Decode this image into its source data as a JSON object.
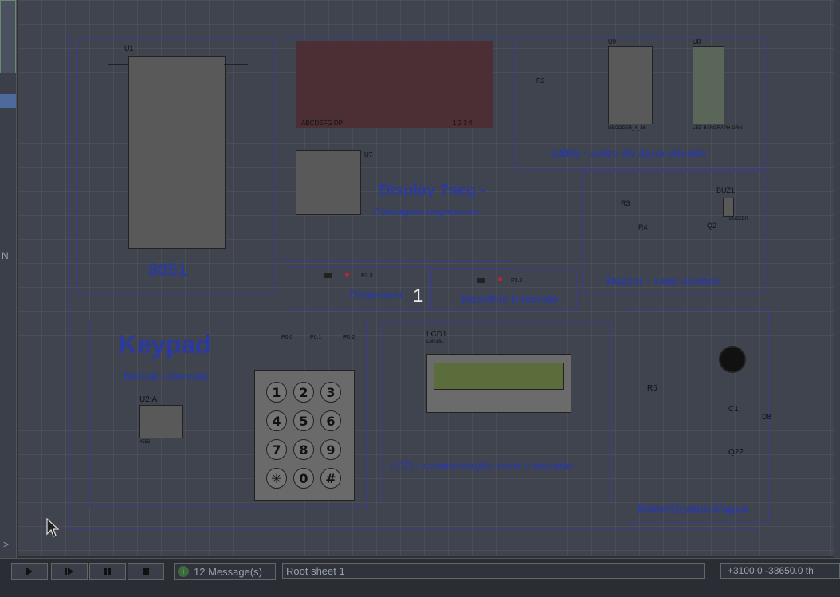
{
  "left_panel": {
    "letter": "N",
    "arrow": ">"
  },
  "blocks": {
    "mcu": {
      "ref": "U1",
      "part": "8051",
      "label": "8051"
    },
    "display7seg": {
      "ref": "U7",
      "title": "Display 7seg -",
      "subtitle": "Contagem regressiva",
      "segment_text": "ABCDEFG DP",
      "digits_text": "1 2 3 4"
    },
    "leds": {
      "ref_decoder": "U9",
      "ref_bargraph": "U8",
      "resistor_ref": "R2",
      "decoder_part": "DECODER_4_16",
      "bargraph_part": "LED-BARGRAPH-GRN",
      "title": "LEDs - aviso de água ativada"
    },
    "buzzer": {
      "refs": [
        "R3",
        "R4",
        "Q2",
        "BUZ1"
      ],
      "part": "BUZZER",
      "title": "Buzzer - sinal sonoro"
    },
    "dispensar": {
      "pin": "P3.3",
      "title": "Dispensar"
    },
    "redefine": {
      "pin": "P3.2",
      "title": "Redefine Intervalo"
    },
    "keypad": {
      "title": "Keypad",
      "subtitle": "Definir intervalo",
      "encoder_ref": "U2:A",
      "encoder_part": "4555",
      "col_labels": [
        "P0.0",
        "P0.1",
        "P0.2"
      ],
      "keys": [
        "1",
        "2",
        "3",
        "4",
        "5",
        "6",
        "7",
        "8",
        "9",
        "✳",
        "0",
        "#"
      ]
    },
    "lcd": {
      "ref": "LCD1",
      "part": "LM016L",
      "title": "LCD - comunicação com o usuario"
    },
    "motor": {
      "refs": [
        "R5",
        "C1",
        "D8",
        "Q22"
      ],
      "title": "Motor/Bomba d'água"
    }
  },
  "badge": "1",
  "statusbar": {
    "controls": [
      "play",
      "step",
      "pause",
      "stop"
    ],
    "messages": "12 Message(s)",
    "sheet": "Root sheet 1",
    "coords": "+3100.0  -33650.0    th"
  }
}
